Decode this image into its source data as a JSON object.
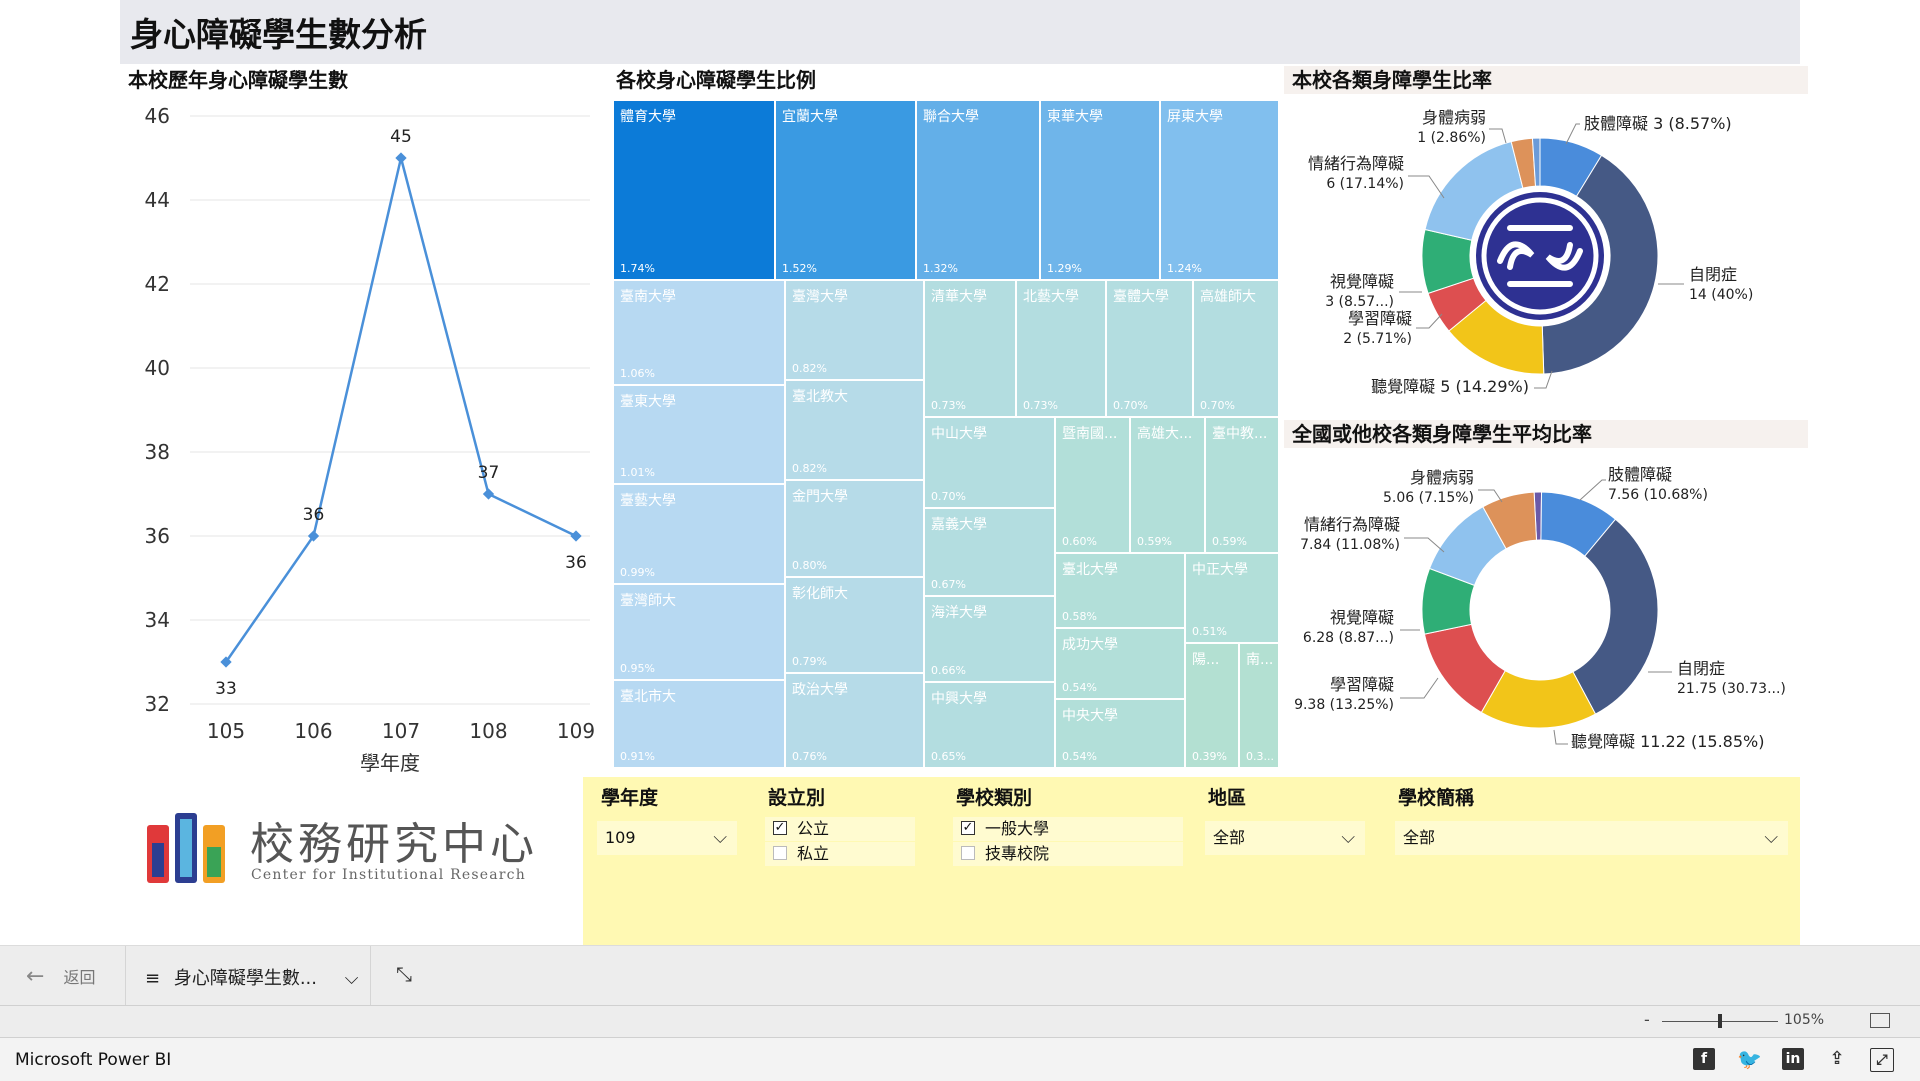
{
  "header": {
    "title": "身心障礙學生數分析"
  },
  "sections": {
    "line": "本校歷年身心障礙學生數",
    "treemap": "各校身心障礙學生比例",
    "donut1": "本校各類身障學生比率",
    "donut2": "全國或他校各類身障學生平均比率"
  },
  "chart_data": [
    {
      "type": "line",
      "title": "本校歷年身心障礙學生數",
      "xlabel": "學年度",
      "ylabel": "",
      "categories": [
        "105",
        "106",
        "107",
        "108",
        "109"
      ],
      "values": [
        33,
        36,
        45,
        37,
        36
      ],
      "ylim": [
        32,
        46
      ],
      "yticks": [
        "32",
        "34",
        "36",
        "38",
        "40",
        "42",
        "44",
        "46"
      ],
      "color": "#4a90d9"
    },
    {
      "type": "treemap",
      "title": "各校身心障礙學生比例",
      "items": [
        {
          "name": "體育大學",
          "value": "1.74%",
          "color": "#0c7bd8"
        },
        {
          "name": "宜蘭大學",
          "value": "1.52%",
          "color": "#3a9ae2"
        },
        {
          "name": "聯合大學",
          "value": "1.32%",
          "color": "#63afe8"
        },
        {
          "name": "東華大學",
          "value": "1.29%",
          "color": "#6fb5ea"
        },
        {
          "name": "屏東大學",
          "value": "1.24%",
          "color": "#81bfee"
        },
        {
          "name": "臺南大學",
          "value": "1.06%",
          "color": "#b7d9f2"
        },
        {
          "name": "臺東大學",
          "value": "1.01%",
          "color": "#b7d9f2"
        },
        {
          "name": "臺藝大學",
          "value": "0.99%",
          "color": "#b7d9f2"
        },
        {
          "name": "臺灣師大",
          "value": "0.95%",
          "color": "#b7d9f2"
        },
        {
          "name": "臺北市大",
          "value": "0.91%",
          "color": "#b7d9f2"
        },
        {
          "name": "臺灣大學",
          "value": "0.82%",
          "color": "#b6dbe8"
        },
        {
          "name": "臺北教大",
          "value": "0.82%",
          "color": "#b6dbe8"
        },
        {
          "name": "金門大學",
          "value": "0.80%",
          "color": "#b6dbe8"
        },
        {
          "name": "彰化師大",
          "value": "0.79%",
          "color": "#b6dbe8"
        },
        {
          "name": "政治大學",
          "value": "0.76%",
          "color": "#b6dbe8"
        },
        {
          "name": "清華大學",
          "value": "0.73%",
          "color": "#b3dde0"
        },
        {
          "name": "北藝大學",
          "value": "0.73%",
          "color": "#b3dde0"
        },
        {
          "name": "臺體大學",
          "value": "0.70%",
          "color": "#b3dde0"
        },
        {
          "name": "高雄師大",
          "value": "0.70%",
          "color": "#b3dde0"
        },
        {
          "name": "中山大學",
          "value": "0.70%",
          "color": "#b3dde0"
        },
        {
          "name": "嘉義大學",
          "value": "0.67%",
          "color": "#b3dde0"
        },
        {
          "name": "海洋大學",
          "value": "0.66%",
          "color": "#b3dde0"
        },
        {
          "name": "中興大學",
          "value": "0.65%",
          "color": "#b3dde0"
        },
        {
          "name": "暨南國...",
          "value": "0.60%",
          "color": "#b2dfd9"
        },
        {
          "name": "高雄大...",
          "value": "0.59%",
          "color": "#b2dfd9"
        },
        {
          "name": "臺中教...",
          "value": "0.59%",
          "color": "#b2dfd9"
        },
        {
          "name": "臺北大學",
          "value": "0.58%",
          "color": "#b2dfd9"
        },
        {
          "name": "中正大學",
          "value": "0.51%",
          "color": "#b2dfd9"
        },
        {
          "name": "成功大學",
          "value": "0.54%",
          "color": "#b2dfd9"
        },
        {
          "name": "中央大學",
          "value": "0.54%",
          "color": "#b2dfd9"
        },
        {
          "name": "陽...",
          "value": "0.39%",
          "color": "#b3e0d2"
        },
        {
          "name": "南...",
          "value": "0.3...",
          "color": "#b3e0d2"
        }
      ]
    },
    {
      "type": "pie",
      "title": "本校各類身障學生比率",
      "slices": [
        {
          "label": "肢體障礙",
          "value": 3,
          "text": "肢體障礙 3 (8.57%)",
          "color": "#4a8cdb"
        },
        {
          "label": "自閉症",
          "value": 14,
          "text": "14 (40%)",
          "color": "#455985"
        },
        {
          "label": "聽覺障礙",
          "value": 5,
          "text": "聽覺障礙 5 (14.29%)",
          "color": "#f2c519"
        },
        {
          "label": "學習障礙",
          "value": 2,
          "text": "2 (5.71%)",
          "color": "#dd4f50"
        },
        {
          "label": "視覺障礙",
          "value": 3,
          "text": "3 (8.57...)",
          "color": "#2fae76"
        },
        {
          "label": "情緒行為障礙",
          "value": 6,
          "text": "6 (17.14%)",
          "color": "#8fc2ee"
        },
        {
          "label": "身體病弱",
          "value": 1,
          "text": "1 (2.86%)",
          "color": "#dd925a"
        },
        {
          "label": "其他",
          "value": 0.35,
          "text": "",
          "color": "#6b9bd9"
        }
      ]
    },
    {
      "type": "pie",
      "title": "全國或他校各類身障學生平均比率",
      "slices": [
        {
          "label": "其他",
          "value": 0.7,
          "text": "",
          "color": "#6a5aa8"
        },
        {
          "label": "肢體障礙",
          "value": 7.56,
          "text": "7.56 (10.68%)",
          "color": "#4a8cdb"
        },
        {
          "label": "自閉症",
          "value": 21.75,
          "text": "21.75 (30.73...)",
          "color": "#455985"
        },
        {
          "label": "聽覺障礙",
          "value": 11.22,
          "text": "聽覺障礙 11.22 (15.85%)",
          "color": "#f2c519"
        },
        {
          "label": "學習障礙",
          "value": 9.38,
          "text": "9.38 (13.25%)",
          "color": "#dd4f50"
        },
        {
          "label": "視覺障礙",
          "value": 6.28,
          "text": "6.28 (8.87...)",
          "color": "#2fae76"
        },
        {
          "label": "情緒行為障礙",
          "value": 7.84,
          "text": "7.84 (11.08%)",
          "color": "#8fc2ee"
        },
        {
          "label": "身體病弱",
          "value": 5.06,
          "text": "5.06 (7.15%)",
          "color": "#dd925a"
        }
      ]
    }
  ],
  "slicers": {
    "year": {
      "label": "學年度",
      "value": "109"
    },
    "setup": {
      "label": "設立別",
      "opt1": "公立",
      "opt2": "私立",
      "opt1_checked": true,
      "opt2_checked": false
    },
    "type": {
      "label": "學校類別",
      "opt1": "一般大學",
      "opt2": "技專校院",
      "opt1_checked": true,
      "opt2_checked": false
    },
    "region": {
      "label": "地區",
      "value": "全部"
    },
    "school": {
      "label": "學校簡稱",
      "value": "全部"
    }
  },
  "logo": {
    "zh": "校務研究中心",
    "en": "Center for Institutional Research"
  },
  "nav": {
    "back": "返回",
    "page": "身心障礙學生數..."
  },
  "zoom": {
    "percent": "105%"
  },
  "footer": {
    "brand": "Microsoft Power BI"
  }
}
